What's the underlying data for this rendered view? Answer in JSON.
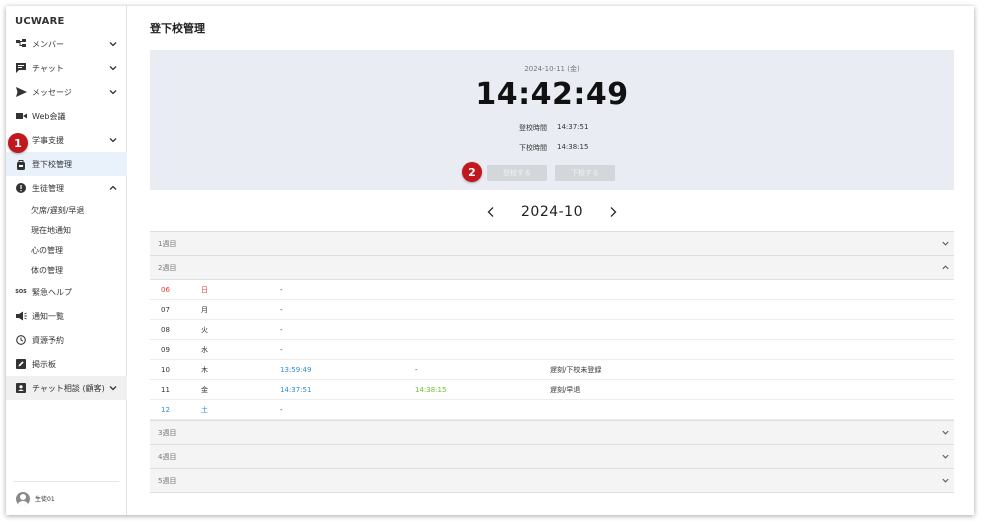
{
  "sidebar": {
    "brand": "UCWARE",
    "items": [
      {
        "label": "メンバー",
        "icon": "members-icon",
        "chevron": "down"
      },
      {
        "label": "チャット",
        "icon": "chat-icon",
        "chevron": "down"
      },
      {
        "label": "メッセージ",
        "icon": "send-icon",
        "chevron": "down"
      },
      {
        "label": "Web会議",
        "icon": "video-icon",
        "chevron": ""
      },
      {
        "label": "学事支援",
        "icon": "school-icon",
        "chevron": "down"
      },
      {
        "label": "登下校管理",
        "icon": "backpack-icon",
        "chevron": ""
      },
      {
        "label": "生徒管理",
        "icon": "alert-icon",
        "chevron": "up"
      }
    ],
    "sub_items": [
      "欠席/遅刻/早退",
      "現在地通知",
      "心の管理",
      "体の管理"
    ],
    "items2": [
      {
        "label": "緊急ヘルプ",
        "icon": "sos-icon",
        "icon_text": "SOS"
      },
      {
        "label": "通知一覧",
        "icon": "megaphone-icon"
      },
      {
        "label": "資源予約",
        "icon": "clock-icon"
      },
      {
        "label": "掲示板",
        "icon": "board-icon"
      },
      {
        "label": "チャット相談 (顧客)",
        "icon": "consult-icon"
      }
    ],
    "user": "生徒01"
  },
  "badges": [
    "1",
    "2"
  ],
  "main": {
    "title": "登下校管理",
    "clock": {
      "date": "2024-10-11 (金)",
      "time": "14:42:49",
      "arrive_label": "登校時間",
      "arrive_value": "14:37:51",
      "leave_label": "下校時間",
      "leave_value": "14:38:15",
      "arrive_button": "登校する",
      "leave_button": "下校する"
    },
    "month": "2024-10",
    "weeks": [
      {
        "label": "1週目",
        "expanded": false
      },
      {
        "label": "2週目",
        "expanded": true
      },
      {
        "label": "3週目",
        "expanded": false
      },
      {
        "label": "4週目",
        "expanded": false
      },
      {
        "label": "5週目",
        "expanded": false
      }
    ],
    "days": [
      {
        "date": "06",
        "weekday": "日",
        "in": "-",
        "out": "",
        "note": "",
        "color": "red"
      },
      {
        "date": "07",
        "weekday": "月",
        "in": "-",
        "out": "",
        "note": "",
        "color": ""
      },
      {
        "date": "08",
        "weekday": "火",
        "in": "-",
        "out": "",
        "note": "",
        "color": ""
      },
      {
        "date": "09",
        "weekday": "水",
        "in": "-",
        "out": "",
        "note": "",
        "color": ""
      },
      {
        "date": "10",
        "weekday": "木",
        "in": "13:59:49",
        "out": "-",
        "note": "遅刻/下校未登録",
        "color": ""
      },
      {
        "date": "11",
        "weekday": "金",
        "in": "14:37:51",
        "out": "14:38:15",
        "note": "遅刻/早退",
        "color": ""
      },
      {
        "date": "12",
        "weekday": "土",
        "in": "-",
        "out": "",
        "note": "",
        "color": "blue"
      }
    ]
  },
  "colors": {
    "accent_blue": "#2f8fd8",
    "sunday_red": "#e53935",
    "leave_green": "#6cbf2f",
    "badge_red": "#c0181e",
    "panel_bg": "#e9edf3"
  }
}
